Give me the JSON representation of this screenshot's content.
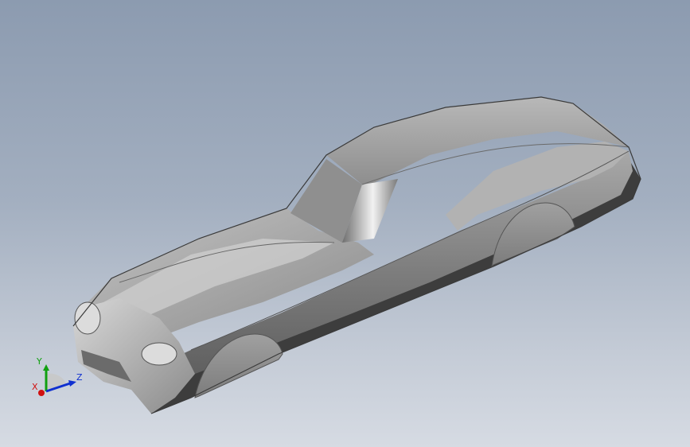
{
  "viewport": {
    "background_top": "#8c9bb0",
    "background_bottom": "#d6dbe3"
  },
  "model": {
    "body_color": "#9a9a9a",
    "highlight_color": "#e6e6e6",
    "shadow_color": "#4a4a4a"
  },
  "triad": {
    "x_label": "X",
    "y_label": "Y",
    "z_label": "Z",
    "x_color": "#d01010",
    "y_color": "#10a010",
    "z_color": "#1030d0"
  }
}
